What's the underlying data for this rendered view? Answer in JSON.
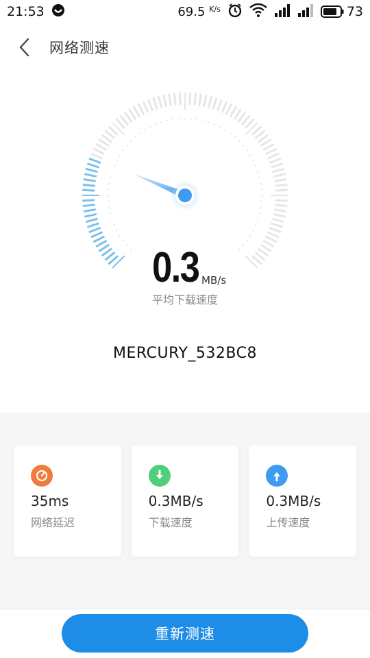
{
  "status_bar": {
    "time": "21:53",
    "net_speed": "69.5",
    "net_speed_unit": "K/s",
    "battery": "73"
  },
  "header": {
    "title": "网络测速"
  },
  "gauge": {
    "progress": 0.25,
    "value": "0.3",
    "unit": "MB/s",
    "caption": "平均下载速度"
  },
  "network": {
    "ssid": "MERCURY_532BC8"
  },
  "stats": [
    {
      "icon": "latency-icon",
      "value": "35ms",
      "label": "网络延迟",
      "color": "#f17a3c"
    },
    {
      "icon": "download-icon",
      "value": "0.3MB/s",
      "label": "下载速度",
      "color": "#4fcf7c"
    },
    {
      "icon": "upload-icon",
      "value": "0.3MB/s",
      "label": "上传速度",
      "color": "#3d9cf0"
    }
  ],
  "actions": {
    "retest_label": "重新测速"
  },
  "colors": {
    "accent": "#1e8de8",
    "gauge_active": "#7ec0ea",
    "gauge_inactive": "#e6e6e6"
  }
}
